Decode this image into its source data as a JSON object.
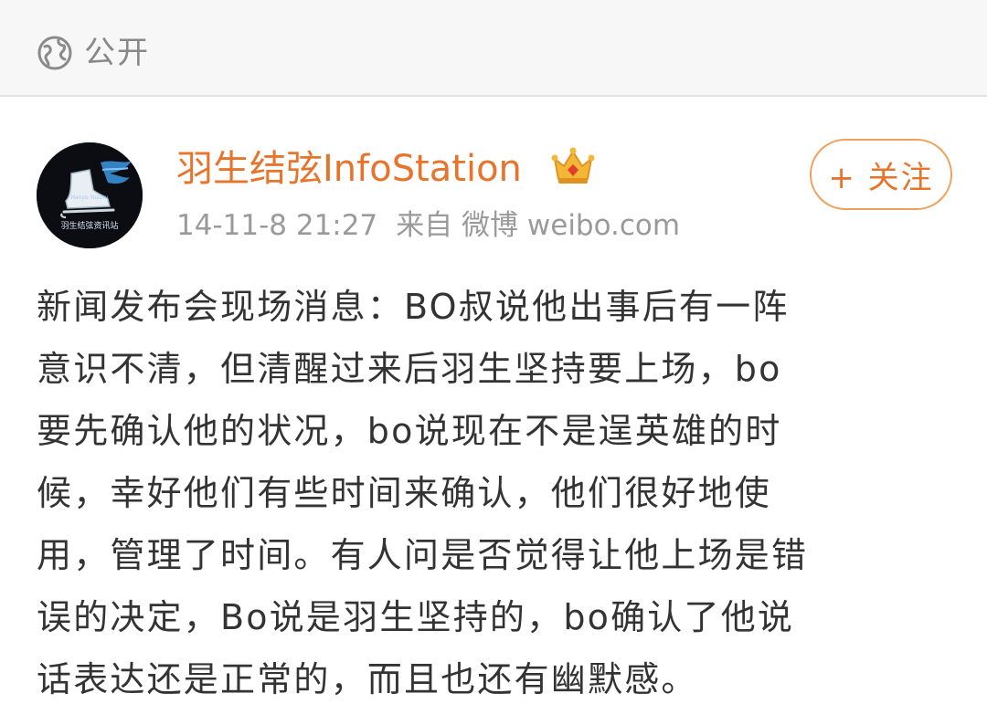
{
  "privacy": {
    "label": "公开",
    "icon": "globe-icon"
  },
  "post": {
    "author": {
      "name": "羽生结弦InfoStation",
      "badge_icon": "crown-icon",
      "avatar_icon": "skate-avatar-icon",
      "avatar_text_top": "Hanyu Yuzuru",
      "avatar_text_bottom": "羽生结弦资讯站"
    },
    "timestamp": "14-11-8 21:27",
    "source": "来自 微博 weibo.com",
    "follow_label": "+ 关注",
    "text_lines": [
      "新闻发布会现场消息：BO叔说他出事后有一阵",
      "意识不清，但清醒过来后羽生坚持要上场，bo",
      "要先确认他的状况，bo说现在不是逞英雄的时",
      "候，幸好他们有些时间来确认，他们很好地使",
      "用，管理了时间。有人问是否觉得让他上场是错",
      "误的决定，Bo说是羽生坚持的，bo确认了他说",
      "话表达还是正常的，而且也还有幽默感。"
    ]
  },
  "colors": {
    "accent": "#e8742c",
    "follow_border": "#f0a05a",
    "text": "#333333",
    "meta": "#9a9a9a",
    "header_bg": "#f7f7f7"
  }
}
